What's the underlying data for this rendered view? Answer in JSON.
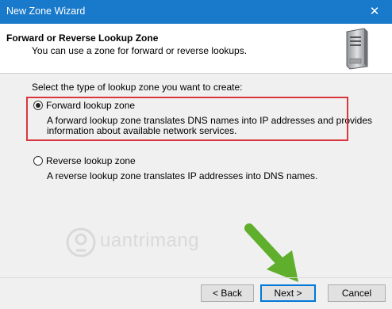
{
  "window": {
    "title": "New Zone Wizard",
    "close_glyph": "✕"
  },
  "header": {
    "title": "Forward or Reverse Lookup Zone",
    "subtitle": "You can use a zone for forward or reverse lookups.",
    "icon": "server-icon"
  },
  "body": {
    "prompt": "Select the type of lookup zone you want to create:",
    "options": [
      {
        "label": "Forward lookup zone",
        "selected": true,
        "description_lines": [
          "A forward lookup zone translates DNS names into IP addresses and provides",
          "information about available network services."
        ]
      },
      {
        "label": "Reverse lookup zone",
        "selected": false,
        "description_lines": [
          "A reverse lookup zone translates IP addresses into DNS names."
        ]
      }
    ]
  },
  "watermark": {
    "text": "uantrimang"
  },
  "buttons": {
    "back": "< Back",
    "next": "Next >",
    "cancel": "Cancel"
  },
  "colors": {
    "titlebar": "#1979ca",
    "highlight": "#d9363e",
    "arrow": "#5fae2c",
    "default_button_border": "#0078d7"
  }
}
